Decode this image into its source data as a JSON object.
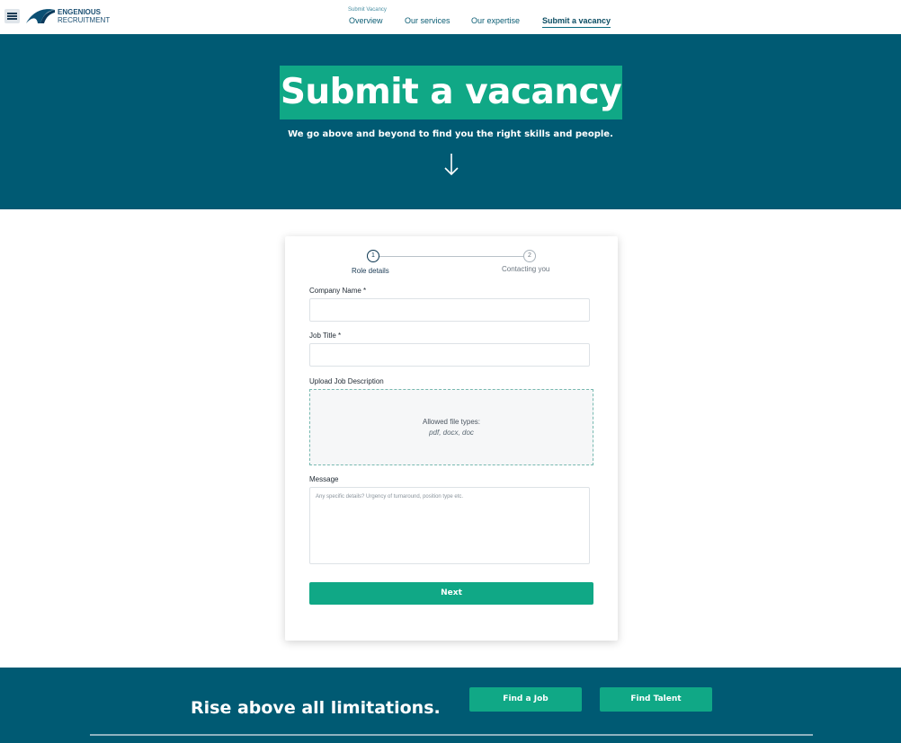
{
  "header": {
    "menu_icon": "hamburger-menu-icon",
    "logo": {
      "line1": "ENGENIOUS",
      "line2": "RECRUITMENT"
    },
    "breadcrumb": "Submit Vacancy",
    "nav": [
      {
        "label": "Overview",
        "active": false
      },
      {
        "label": "Our services",
        "active": false
      },
      {
        "label": "Our expertise",
        "active": false
      },
      {
        "label": "Submit a vacancy",
        "active": true
      }
    ]
  },
  "hero": {
    "title": "Submit a vacancy",
    "subtitle": "We go above and beyond to find you the right skills and people.",
    "arrow_icon": "arrow-down-icon"
  },
  "form": {
    "steps": [
      {
        "number": "1",
        "label": "Role details",
        "active": true
      },
      {
        "number": "2",
        "label": "Contacting you",
        "active": false
      }
    ],
    "company_name_label": "Company Name *",
    "company_name_value": "",
    "job_title_label": "Job Title *",
    "job_title_value": "",
    "upload_label": "Upload Job Description",
    "upload_hint": "Allowed file types:",
    "upload_types": "pdf, docx, doc",
    "message_label": "Message",
    "message_placeholder": "Any specific details? Urgency of turnaround, position type etc.",
    "next_label": "Next"
  },
  "footer": {
    "tagline": "Rise above all limitations.",
    "find_job_label": "Find a Job",
    "find_talent_label": "Find Talent"
  },
  "colors": {
    "brand_teal": "#005a73",
    "accent_green": "#10a886",
    "white": "#ffffff"
  }
}
